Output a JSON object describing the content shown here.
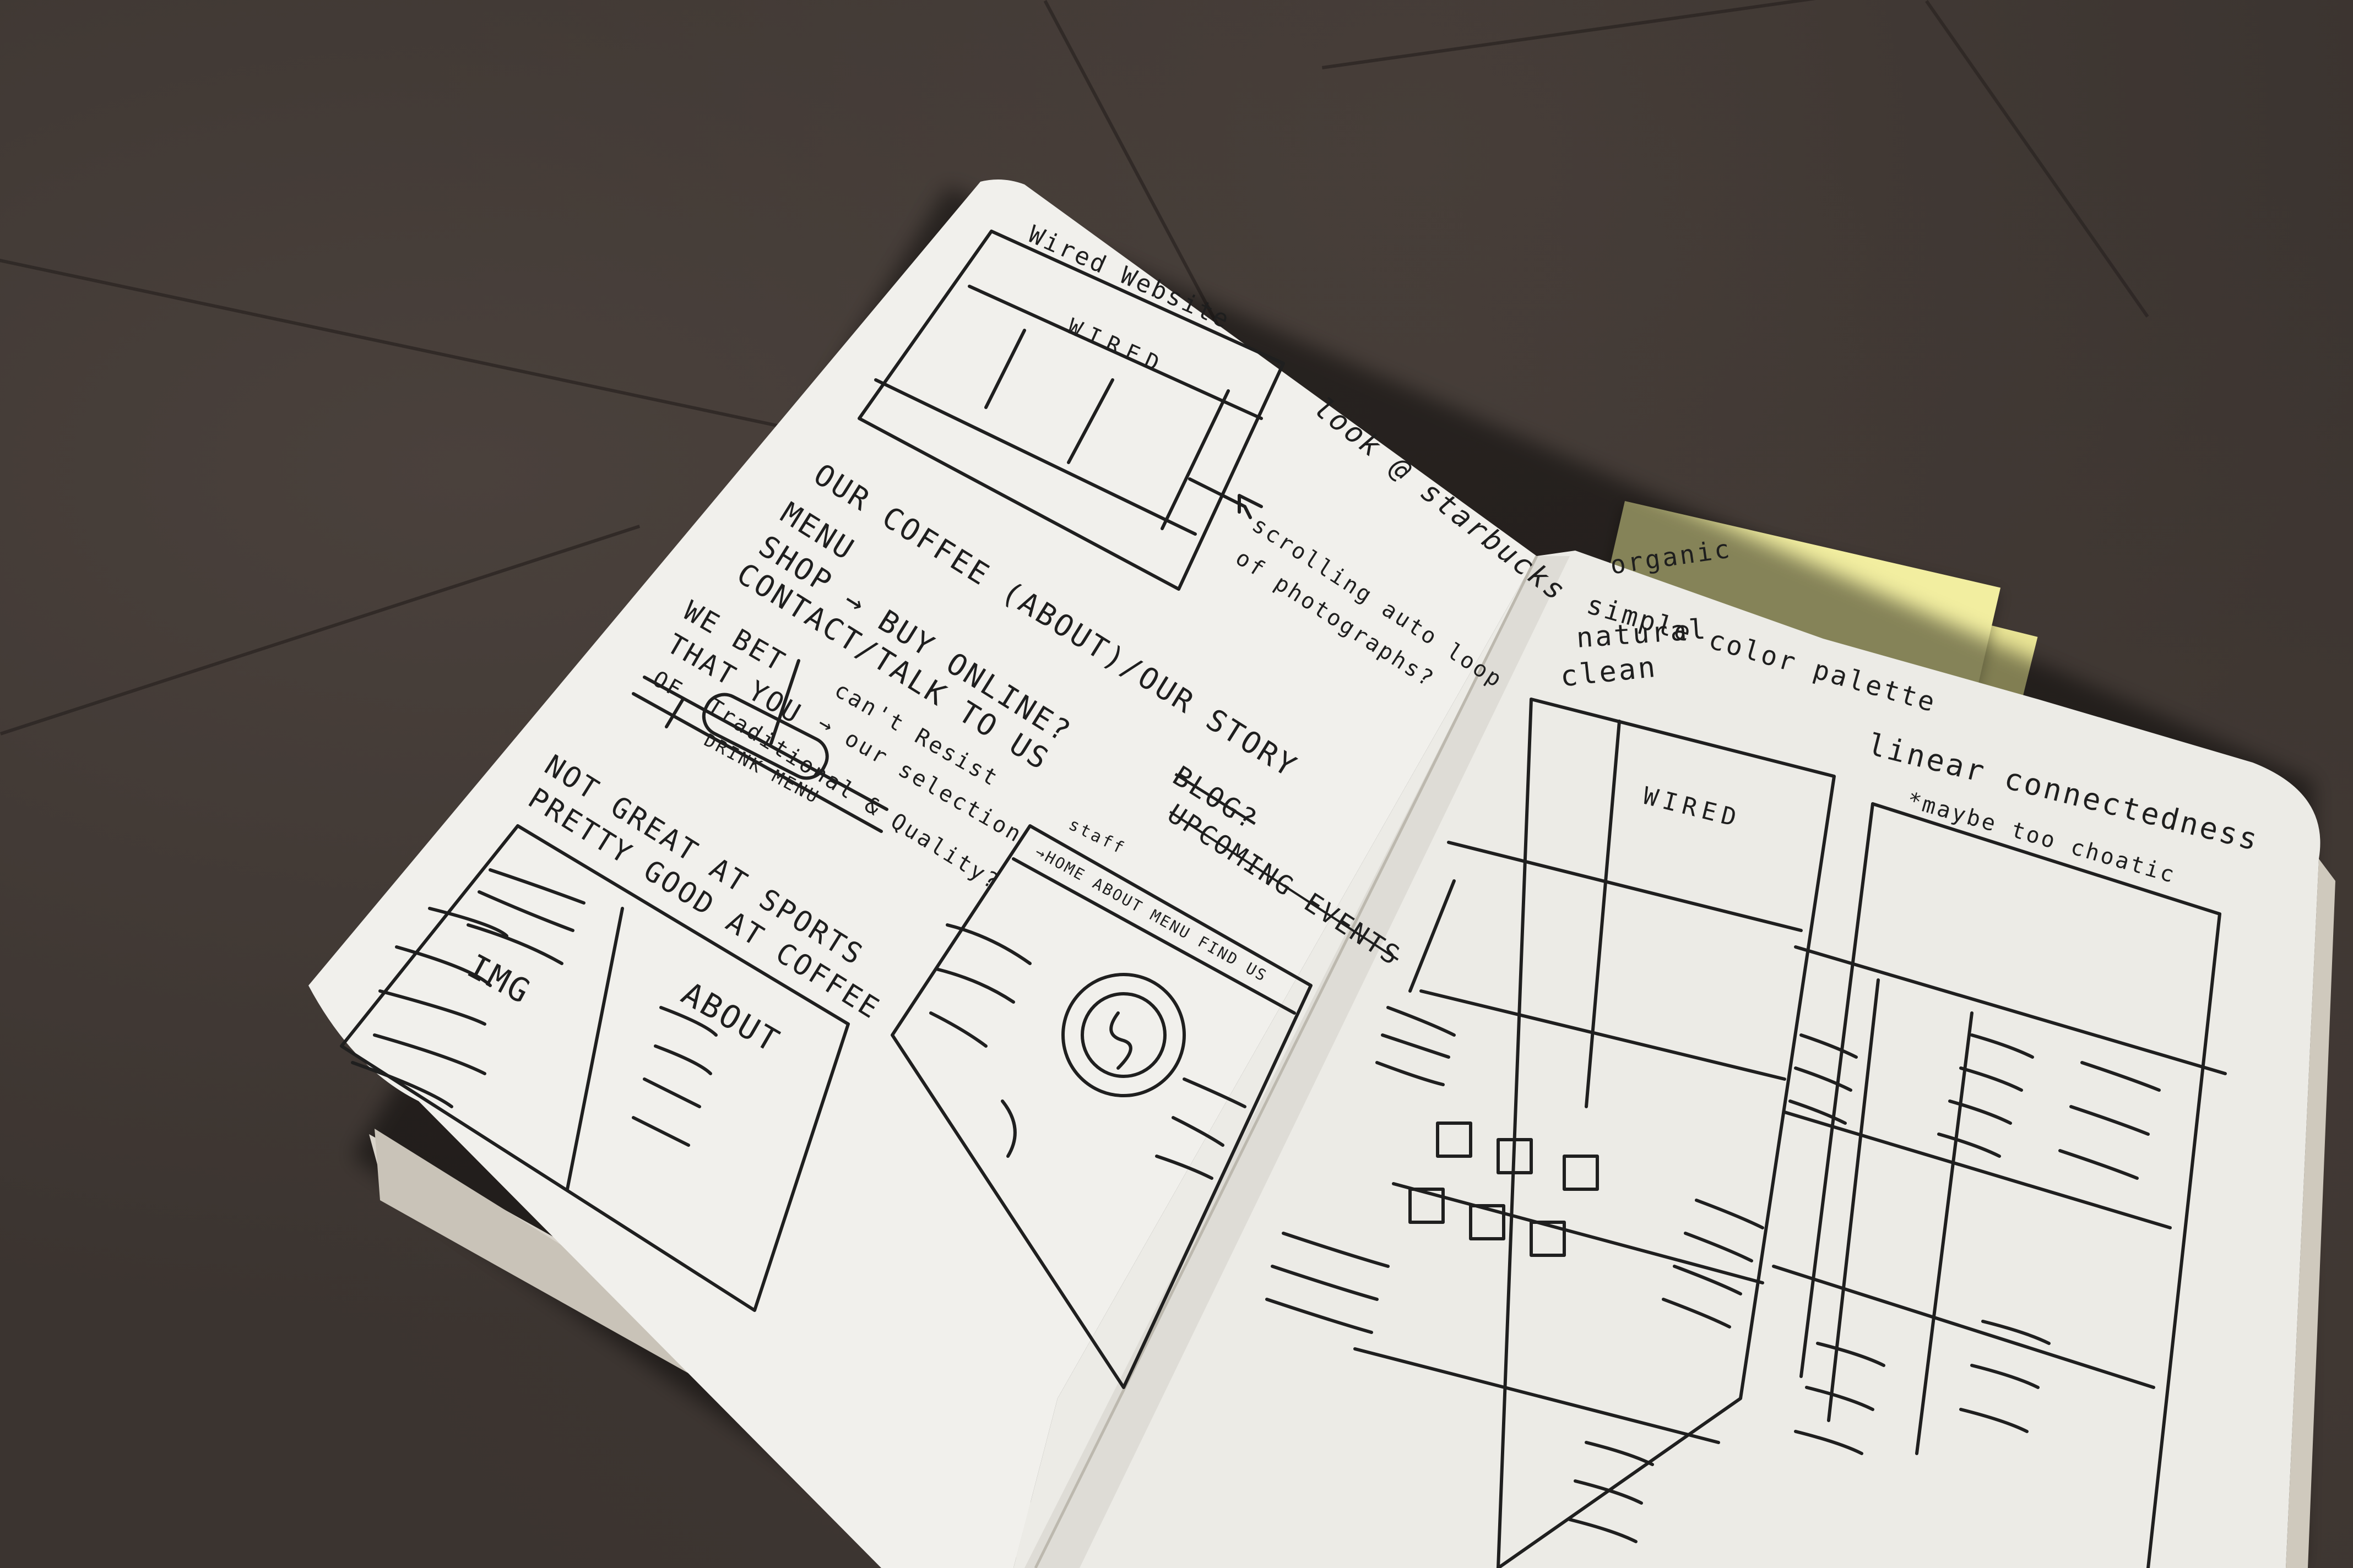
{
  "left_page": {
    "header": "Wired Website",
    "wired_label": "WIRED",
    "starbucks_note": "look @ starbucks",
    "scroll_note_line1": "scrolling auto loop",
    "scroll_note_line2": "of photographs?",
    "nav_line1": "OUR COFFEE (ABOUT)/OUR STORY",
    "nav_line2": "MENU",
    "nav_line3": "SHOP → BUY ONLINE?",
    "nav_line4": "CONTACT/TALK TO US",
    "bet_line1": "WE BET",
    "bet_line2": "THAT YOU",
    "bet_line3": "can't Resist",
    "bet_line4": "→ our selection",
    "of_label": "OF",
    "traditional_line": "Traditional & Quality?",
    "drink_menu": "DRINK MENU",
    "sports_line1": "NOT GREAT AT SPORTS",
    "sports_line2": "PRETTY GOOD AT COFFEE",
    "img_label": "IMG",
    "about_label": "ABOUT",
    "blog_label": "BLOG?",
    "events_label": "UPCOMING EVENTS",
    "staff_label": "staff",
    "nav_bar": "→HOME ABOUT MENU FIND US"
  },
  "right_page": {
    "organic": "organic",
    "palette": "simple color palette",
    "natural": "natural",
    "clean": "clean",
    "wired_label": "WIRED",
    "linear": "linear connectedness",
    "chaotic": "*maybe too choatic"
  }
}
